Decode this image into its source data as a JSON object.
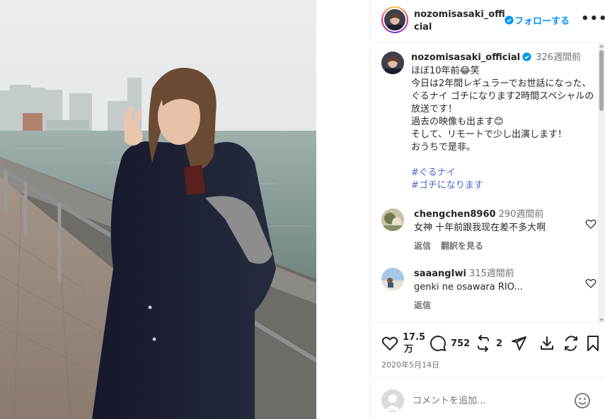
{
  "post": {
    "username": "nozomisasaki_official",
    "follow_label": "フォローする",
    "more_label": "•••"
  },
  "caption": {
    "username": "nozomisasaki_official",
    "time": "326週間前",
    "lines": [
      "ほぼ10年前😂笑",
      "今日は2年間レギュラーでお世話になった、ぐるナイ ゴチになります2時間スペシャルの放送です！",
      "過去の映像も出ます😊",
      "そして、リモートで少し出演します！",
      "おうちで是非。"
    ],
    "hashtags": [
      "#ぐるナイ",
      "#ゴチになります"
    ]
  },
  "comments": [
    {
      "username": "chengchen8960",
      "time": "290週間前",
      "text": "女神 十年前跟我现在差不多大啊",
      "reply_label": "返信",
      "translate_label": "翻訳を見る"
    },
    {
      "username": "saaangIwi",
      "time": "315週間前",
      "text": "genki ne osawara RIO...",
      "reply_label": "返信"
    }
  ],
  "stats": {
    "likes": "17.5",
    "likes_unit": "万",
    "comments": "752",
    "reposts": "2"
  },
  "date": "2020年5月14日",
  "comment_input": {
    "placeholder": "コメントを追加..."
  },
  "colors": {
    "accent": "#0095f6",
    "hashtag": "#4a66c9",
    "verified": "#0095f6"
  }
}
